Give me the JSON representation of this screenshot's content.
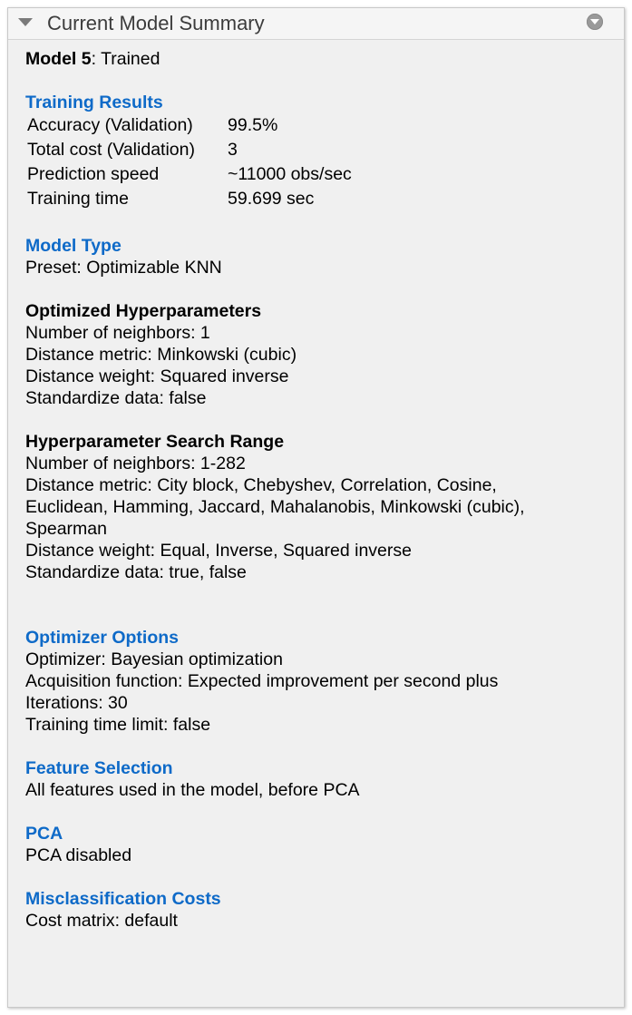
{
  "panel": {
    "title": "Current Model Summary"
  },
  "model": {
    "name": "Model 5",
    "status": ": Trained"
  },
  "training_results": {
    "title": "Training Results",
    "rows": [
      {
        "label": "Accuracy (Validation)",
        "value": "99.5%"
      },
      {
        "label": "Total cost (Validation)",
        "value": "3"
      },
      {
        "label": "Prediction speed",
        "value": "~11000 obs/sec"
      },
      {
        "label": "Training time",
        "value": "59.699 sec"
      }
    ]
  },
  "model_type": {
    "title": "Model Type",
    "preset": "Preset: Optimizable KNN"
  },
  "optimized_hyperparameters": {
    "title": "Optimized Hyperparameters",
    "lines": [
      "Number of neighbors: 1",
      "Distance metric: Minkowski (cubic)",
      "Distance weight: Squared inverse",
      "Standardize data: false"
    ]
  },
  "search_range": {
    "title": "Hyperparameter Search Range",
    "lines": [
      "Number of neighbors: 1-282",
      "Distance metric: City block, Chebyshev, Correlation, Cosine, Euclidean, Hamming, Jaccard, Mahalanobis, Minkowski (cubic), Spearman",
      "Distance weight: Equal, Inverse, Squared inverse",
      "Standardize data: true, false"
    ]
  },
  "optimizer_options": {
    "title": "Optimizer Options",
    "lines": [
      "Optimizer: Bayesian optimization",
      "Acquisition function: Expected improvement per second plus",
      "Iterations: 30",
      "Training time limit: false"
    ]
  },
  "feature_selection": {
    "title": "Feature Selection",
    "text": "All features used in the model, before PCA"
  },
  "pca": {
    "title": "PCA",
    "text": "PCA disabled"
  },
  "misclassification_costs": {
    "title": "Misclassification Costs",
    "text": "Cost matrix: default"
  },
  "colors": {
    "section_title": "#0e6ac8",
    "panel_bg": "#f0f0f0",
    "header_bg": "#f5f5f5"
  },
  "icons": {
    "collapse": "caret-down-icon",
    "menu": "panel-menu-icon"
  }
}
